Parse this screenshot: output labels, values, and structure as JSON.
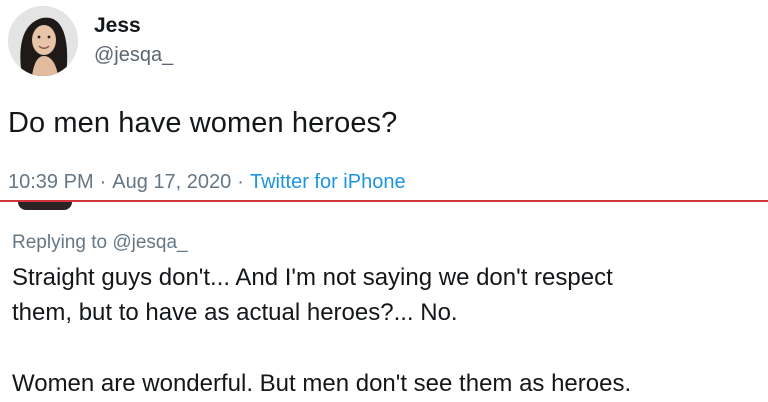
{
  "tweet": {
    "avatar_icon": "user-photo-icon",
    "display_name": "Jess",
    "handle": "@jesqa_",
    "text": "Do men have women heroes?",
    "time": "10:39 PM",
    "separator": "·",
    "date": "Aug 17, 2020",
    "source": "Twitter for iPhone"
  },
  "reply": {
    "replying_to": "Replying to @jesqa_",
    "lines": [
      "Straight guys don't... And I'm not saying we don't respect",
      "them, but to have as actual heroes?... No.",
      "Women are wonderful. But men don't see them as heroes."
    ]
  },
  "colors": {
    "text": "#14171a",
    "muted": "#657786",
    "link": "#1b95e0",
    "divider": "#d0343a"
  }
}
